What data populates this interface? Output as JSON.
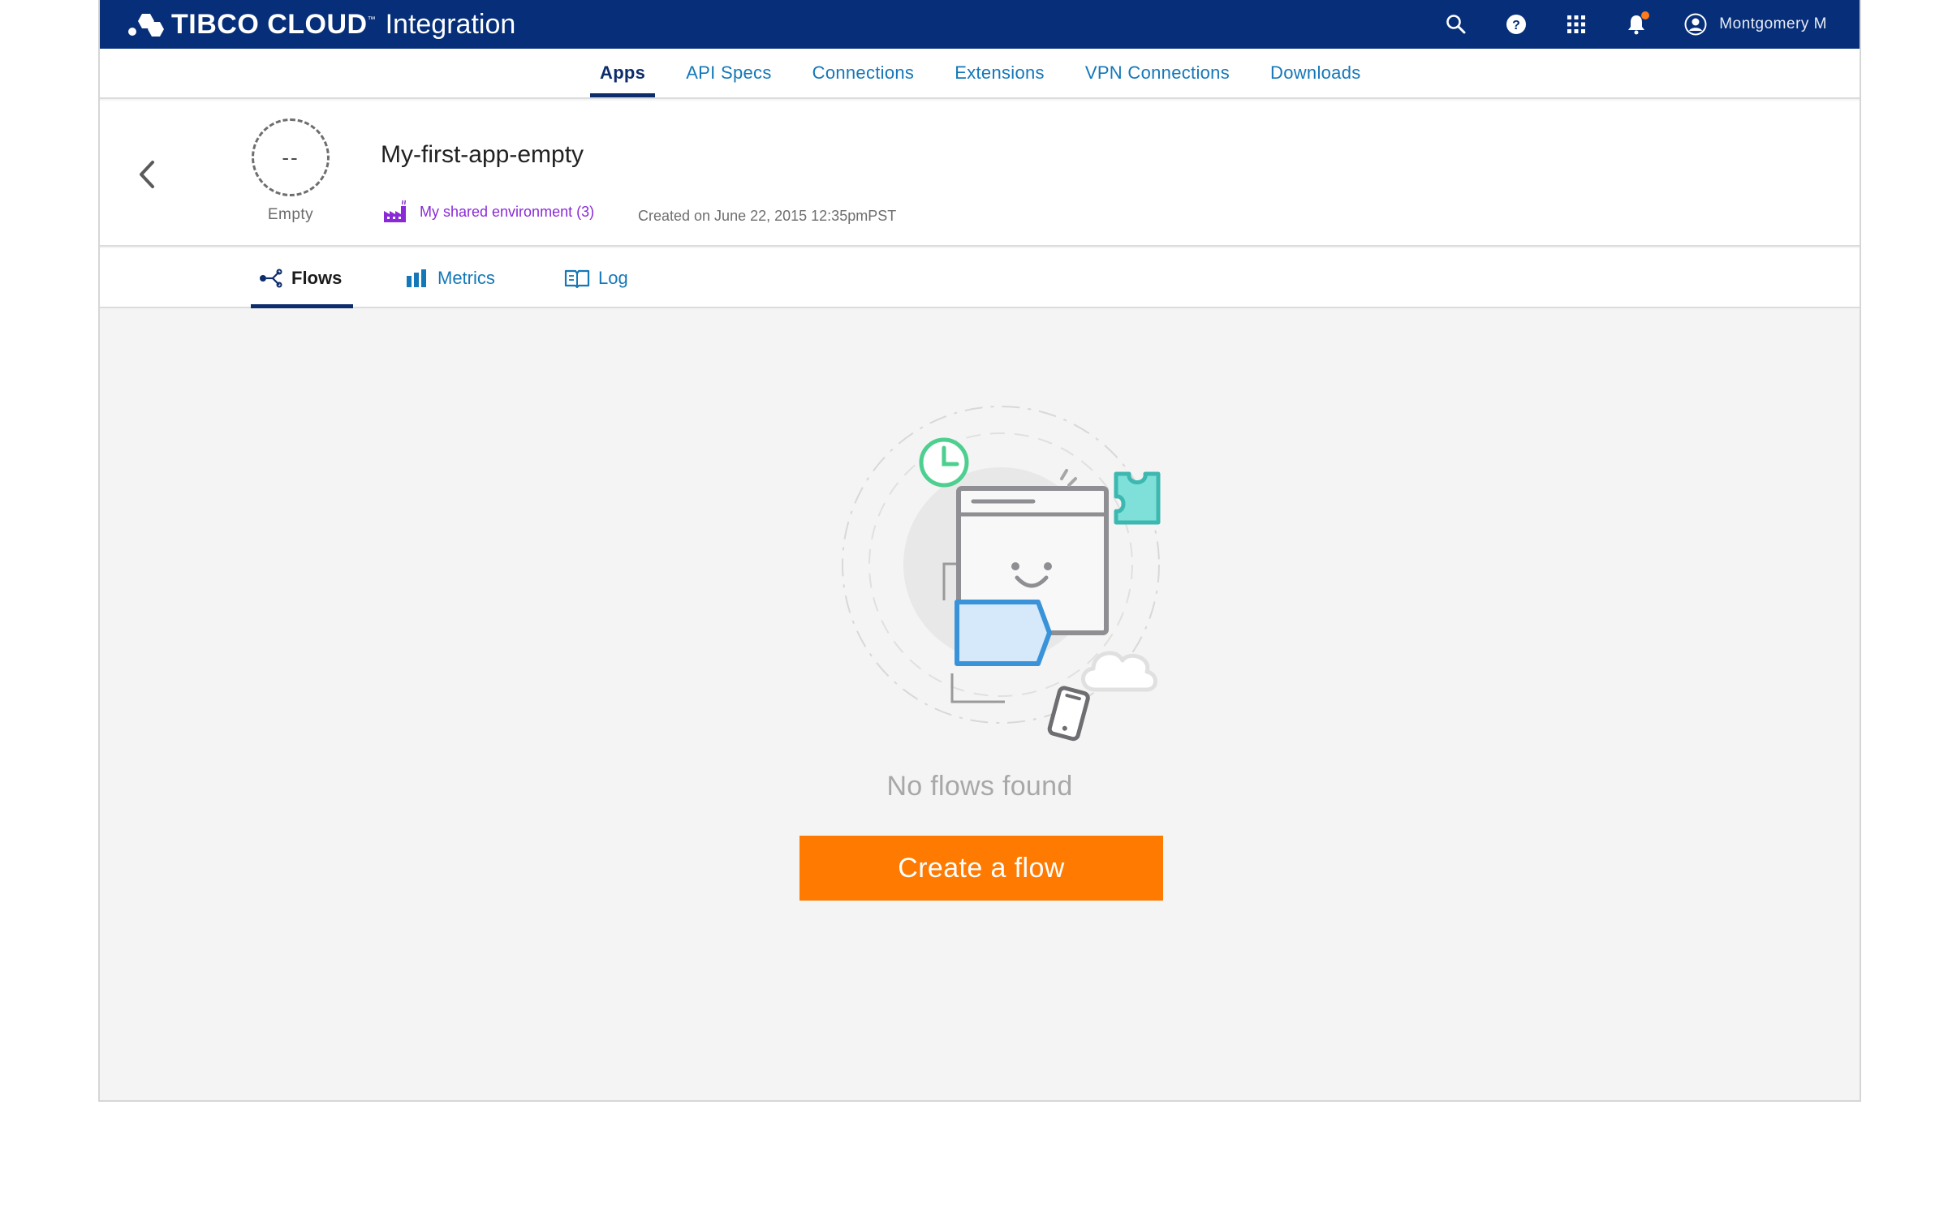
{
  "header": {
    "brand_name": "TIBCO CLOUD",
    "brand_tm": "™",
    "product": "Integration",
    "user_name": "Montgomery M",
    "icons": [
      "search-icon",
      "help-icon",
      "apps-grid-icon",
      "bell-icon",
      "user-avatar-icon"
    ],
    "notification_color": "#ff7a1a"
  },
  "nav": {
    "items": [
      {
        "label": "Apps",
        "active": true
      },
      {
        "label": "API Specs"
      },
      {
        "label": "Connections"
      },
      {
        "label": "Extensions"
      },
      {
        "label": "VPN Connections"
      },
      {
        "label": "Downloads"
      }
    ]
  },
  "app": {
    "status_symbol": "--",
    "status_label": "Empty",
    "title": "My-first-app-empty",
    "environment": "My shared environment (3)",
    "created": "Created on June 22, 2015 12:35pmPST"
  },
  "tabs": {
    "flows": "Flows",
    "metrics": "Metrics",
    "log": "Log"
  },
  "empty_state": {
    "message": "No flows found",
    "cta_label": "Create a flow"
  },
  "colors": {
    "topbar": "#062e79",
    "accent_blue": "#1477b8",
    "active_nav": "#0d2c6b",
    "cta": "#ff7a00",
    "environment": "#8a2ad6"
  }
}
